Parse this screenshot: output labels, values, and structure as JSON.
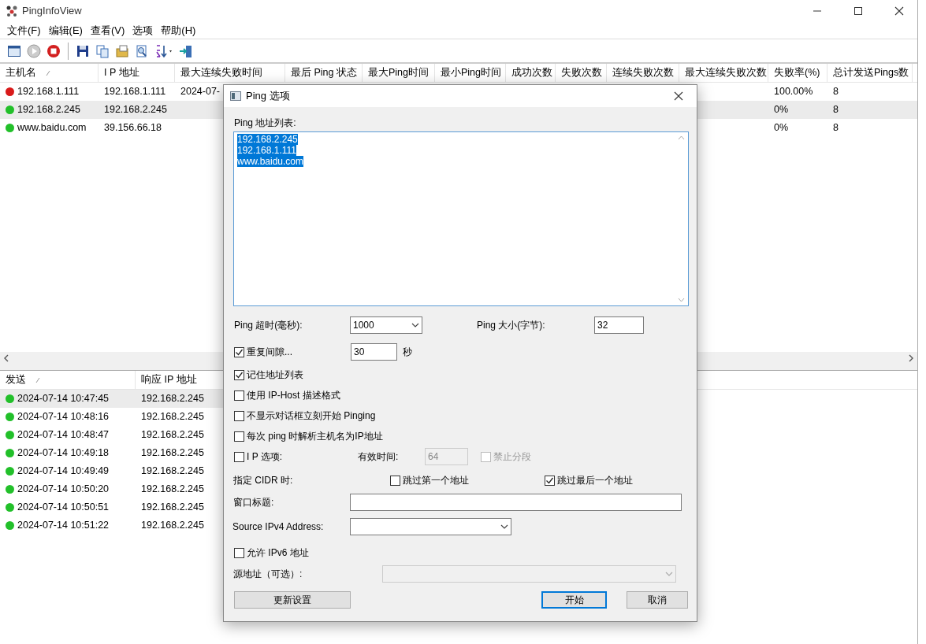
{
  "window": {
    "title": "PingInfoView"
  },
  "menu": [
    "文件(F)",
    "编辑(E)",
    "查看(V)",
    "选项",
    "帮助(H)"
  ],
  "toolbar": [
    {
      "kind": "window",
      "disabled": false
    },
    {
      "kind": "play",
      "disabled": true
    },
    {
      "kind": "stop",
      "disabled": false
    },
    {
      "kind": "separator"
    },
    {
      "kind": "save",
      "disabled": false
    },
    {
      "kind": "copy",
      "disabled": false
    },
    {
      "kind": "properties",
      "disabled": false
    },
    {
      "kind": "find",
      "disabled": false
    },
    {
      "kind": "sort",
      "disabled": false
    },
    {
      "kind": "exit",
      "disabled": false
    }
  ],
  "hosts_table": {
    "columns": [
      {
        "label": "主机名",
        "sorted": true
      },
      {
        "label": "I P 地址",
        "sorted": false
      },
      {
        "label": "最大连续失败时间",
        "sorted": false
      },
      {
        "label": "最后 Ping 状态",
        "sorted": false
      },
      {
        "label": "最大Ping时间",
        "sorted": false
      },
      {
        "label": "最小Ping时间",
        "sorted": false
      },
      {
        "label": "成功次数",
        "sorted": false
      },
      {
        "label": "失败次数",
        "sorted": false
      },
      {
        "label": "连续失败次数",
        "sorted": false
      },
      {
        "label": "最大连续失败次数",
        "sorted": false
      },
      {
        "label": "失败率(%)",
        "sorted": false
      },
      {
        "label": "总计发送Pings数",
        "sorted": false
      }
    ],
    "rows": [
      {
        "selected": false,
        "color": "#d91a1a",
        "host": "192.168.1.111",
        "ip": "192.168.1.111",
        "max_fail_time": "2024-07-",
        "failure_rate": "100.00%",
        "total_pings": "8"
      },
      {
        "selected": true,
        "color": "#22c02a",
        "host": "192.168.2.245",
        "ip": "192.168.2.245",
        "failure_rate": "0%",
        "total_pings": "8"
      },
      {
        "selected": false,
        "color": "#22c02a",
        "host": "www.baidu.com",
        "ip": "39.156.66.18",
        "failure_rate": "0%",
        "total_pings": "8"
      }
    ]
  },
  "log_table": {
    "columns": [
      {
        "label": "发送",
        "sorted": true
      },
      {
        "label": "响应 IP 地址",
        "sorted": false
      }
    ],
    "rows": [
      {
        "selected": true,
        "color": "#22c02a",
        "sent": "2024-07-14 10:47:45",
        "reply_ip": "192.168.2.245"
      },
      {
        "selected": false,
        "color": "#22c02a",
        "sent": "2024-07-14 10:48:16",
        "reply_ip": "192.168.2.245"
      },
      {
        "selected": false,
        "color": "#22c02a",
        "sent": "2024-07-14 10:48:47",
        "reply_ip": "192.168.2.245"
      },
      {
        "selected": false,
        "color": "#22c02a",
        "sent": "2024-07-14 10:49:18",
        "reply_ip": "192.168.2.245"
      },
      {
        "selected": false,
        "color": "#22c02a",
        "sent": "2024-07-14 10:49:49",
        "reply_ip": "192.168.2.245"
      },
      {
        "selected": false,
        "color": "#22c02a",
        "sent": "2024-07-14 10:50:20",
        "reply_ip": "192.168.2.245"
      },
      {
        "selected": false,
        "color": "#22c02a",
        "sent": "2024-07-14 10:50:51",
        "reply_ip": "192.168.2.245"
      },
      {
        "selected": false,
        "color": "#22c02a",
        "sent": "2024-07-14 10:51:22",
        "reply_ip": "192.168.2.245"
      }
    ]
  },
  "dialog": {
    "title": "Ping 选项",
    "address_list": {
      "label": "Ping 地址列表:",
      "lines": [
        {
          "text": "192.168.2.245",
          "selected": true
        },
        {
          "text": "192.168.1.111",
          "selected": true
        },
        {
          "text": "www.baidu.com",
          "selected": true
        }
      ]
    },
    "timeout": {
      "label": "Ping 超时(毫秒):",
      "value": "1000"
    },
    "packet_size": {
      "label": "Ping 大小(字节):",
      "value": "32"
    },
    "repeat": {
      "label": "重复间隙...",
      "checked": true,
      "value": "30",
      "unit": "秒"
    },
    "options": [
      {
        "label": "记住地址列表",
        "checked": true
      },
      {
        "label": "使用 IP-Host 描述格式",
        "checked": false
      },
      {
        "label": "不显示对话框立刻开始 Pinging",
        "checked": false
      },
      {
        "label": "每次 ping 时解析主机名为IP地址",
        "checked": false
      }
    ],
    "ip_options": {
      "label": "I P 选项:",
      "checked": false,
      "ttl_label": "有效时间:",
      "ttl_value": "64",
      "ttl_disabled": true,
      "dont_fragment": {
        "label": "禁止分段",
        "checked": false,
        "disabled": true
      }
    },
    "cidr": {
      "label": "指定 CIDR 时:",
      "options": [
        {
          "label": "跳过第一个地址",
          "checked": false
        },
        {
          "label": "跳过最后一个地址",
          "checked": true
        }
      ]
    },
    "window_title": {
      "label": "窗口标题:"
    },
    "source_ipv4": {
      "label": "Source IPv4 Address:"
    },
    "allow_ipv6": {
      "label": "允许 IPv6 地址",
      "checked": false
    },
    "source_address": {
      "label": "源地址（可选）:",
      "disabled": true
    },
    "buttons": [
      {
        "label": "更新设置",
        "default": false
      },
      {
        "label": "开始",
        "default": true
      },
      {
        "label": "取消",
        "default": false
      }
    ]
  }
}
